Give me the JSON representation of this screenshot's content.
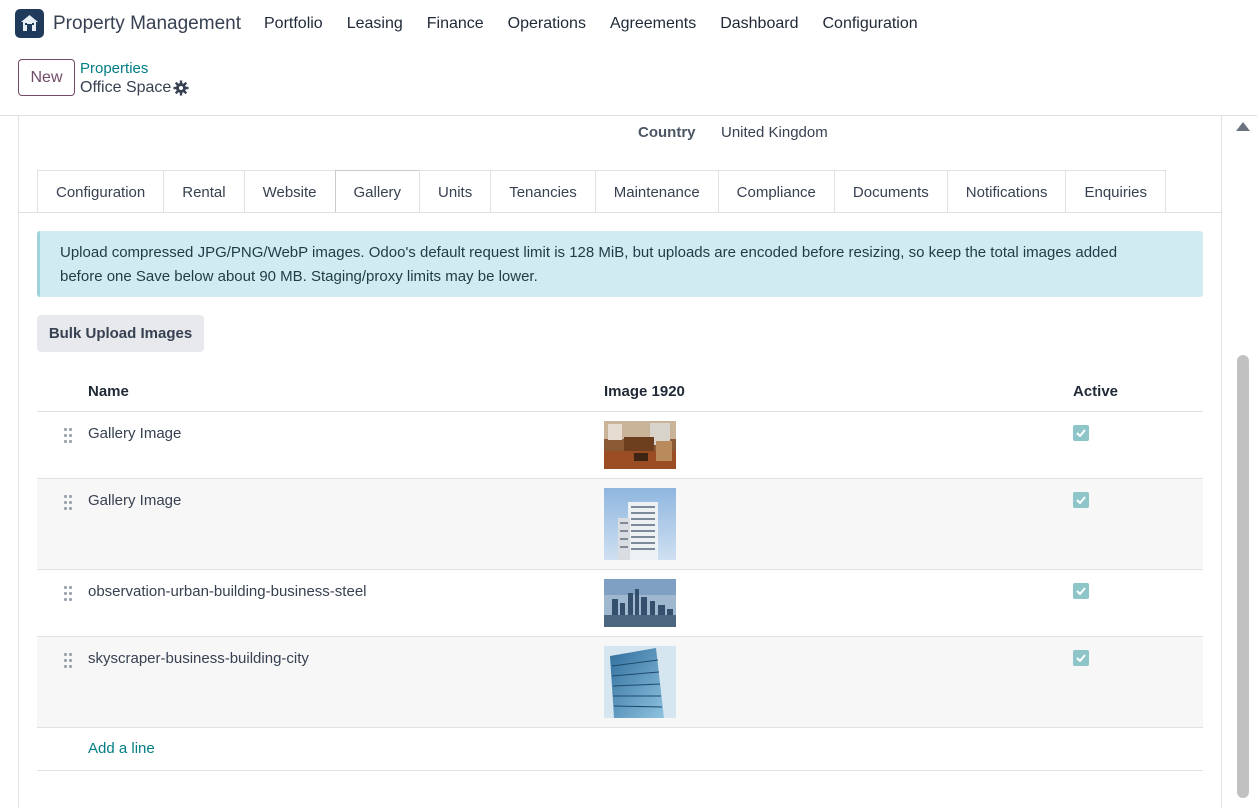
{
  "app": {
    "name": "Property Management",
    "logo_icon": "home-icon"
  },
  "menu": [
    "Portfolio",
    "Leasing",
    "Finance",
    "Operations",
    "Agreements",
    "Dashboard",
    "Configuration"
  ],
  "control_panel": {
    "new_label": "New",
    "breadcrumb_parent": "Properties",
    "breadcrumb_current": "Office Space"
  },
  "form": {
    "country_label": "Country",
    "country_value": "United Kingdom"
  },
  "tabs": [
    "Configuration",
    "Rental",
    "Website",
    "Gallery",
    "Units",
    "Tenancies",
    "Maintenance",
    "Compliance",
    "Documents",
    "Notifications",
    "Enquiries"
  ],
  "active_tab": "Gallery",
  "alert": {
    "line1": "Upload compressed JPG/PNG/WebP images. Odoo's default request limit is 128 MiB, but uploads are encoded before resizing, so keep the total images added",
    "line2": "before one Save below about 90 MB. Staging/proxy limits may be lower."
  },
  "bulk_upload_label": "Bulk Upload Images",
  "grid": {
    "columns": {
      "name": "Name",
      "image": "Image 1920",
      "active": "Active"
    },
    "rows": [
      {
        "name": "Gallery Image",
        "image": "interior-room-photo",
        "active": true
      },
      {
        "name": "Gallery Image",
        "image": "white-tower-photo",
        "active": true
      },
      {
        "name": "observation-urban-building-business-steel",
        "image": "city-skyline-photo",
        "active": true
      },
      {
        "name": "skyscraper-business-building-city",
        "image": "glass-skyscraper-photo",
        "active": true
      }
    ],
    "add_line": "Add a line"
  },
  "colors": {
    "accent": "#017e84",
    "brand": "#714b67",
    "alert_bg": "#d1ecf1",
    "checkbox": "#8ec5c8"
  }
}
